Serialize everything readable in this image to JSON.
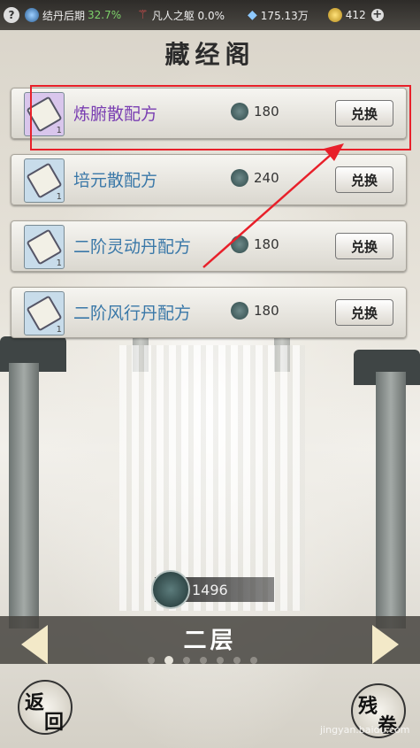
{
  "topbar": {
    "help": "?",
    "realm": "结丹后期",
    "realm_pct": "32.7%",
    "body": "凡人之躯 0.0%",
    "spirit_stones": "175.13万",
    "gold": "412",
    "plus": "+"
  },
  "title": "藏经阁",
  "items": [
    {
      "name": "炼腑散配方",
      "qty": "1",
      "cost": "180",
      "button": "兑换",
      "color": "#7a3fb2",
      "frame": "#d9c6ec"
    },
    {
      "name": "培元散配方",
      "qty": "1",
      "cost": "240",
      "button": "兑换",
      "color": "#3a78a8",
      "frame": "#c8dcea"
    },
    {
      "name": "二阶灵动丹配方",
      "qty": "1",
      "cost": "180",
      "button": "兑换",
      "color": "#3a78a8",
      "frame": "#c8dcea"
    },
    {
      "name": "二阶风行丹配方",
      "qty": "1",
      "cost": "180",
      "button": "兑换",
      "color": "#3a78a8",
      "frame": "#c8dcea"
    }
  ],
  "balance": "1496",
  "floor": "二层",
  "return_label": "返回",
  "right_label": "残卷",
  "watermark": "jingyan.baidu.com",
  "highlight_color": "#e8202a"
}
